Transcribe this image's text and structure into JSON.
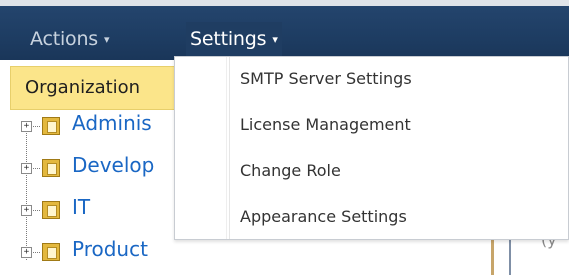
{
  "topbar": {
    "actions_label": "Actions",
    "settings_label": "Settings",
    "caret": "▾"
  },
  "sidebar": {
    "header": "Organization",
    "tree": [
      {
        "label": "Adminis",
        "expander": "+"
      },
      {
        "label": "Develop",
        "expander": "+"
      },
      {
        "label": "IT",
        "expander": "+"
      },
      {
        "label": "Product",
        "expander": "+"
      }
    ]
  },
  "settings_menu": {
    "items": [
      "SMTP Server Settings",
      "License Management",
      "Change Role",
      "Appearance Settings"
    ]
  },
  "right_fragment": "(y"
}
